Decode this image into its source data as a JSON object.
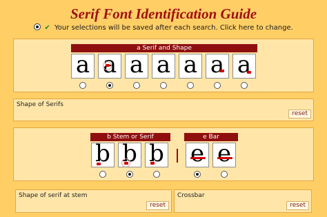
{
  "header": {
    "title": "Serif Font Identification Guide",
    "notice": "Your selections will be saved after each search. Click here to change."
  },
  "colors": {
    "accent": "#8f0f0f",
    "title": "#a01010",
    "background": "#ffcf66",
    "panel": "#ffe6a8"
  },
  "icons": {
    "saved": "check-icon",
    "option": "radio-button"
  },
  "section_a": {
    "group_label": "a Serif and Shape",
    "options": [
      "a",
      "a",
      "a",
      "a",
      "a",
      "a",
      "a"
    ],
    "selected_index": 1,
    "field_label": "Shape of Serifs",
    "reset_label": "reset"
  },
  "section_b": {
    "group_label": "b Stem or Serif",
    "options": [
      "b",
      "b",
      "b"
    ],
    "selected_index": 1,
    "field_label": "Shape of serif at stem",
    "reset_label": "reset"
  },
  "section_e": {
    "group_label": "e Bar",
    "options": [
      "e",
      "e"
    ],
    "selected_index": 0,
    "field_label": "Crossbar",
    "reset_label": "reset"
  }
}
